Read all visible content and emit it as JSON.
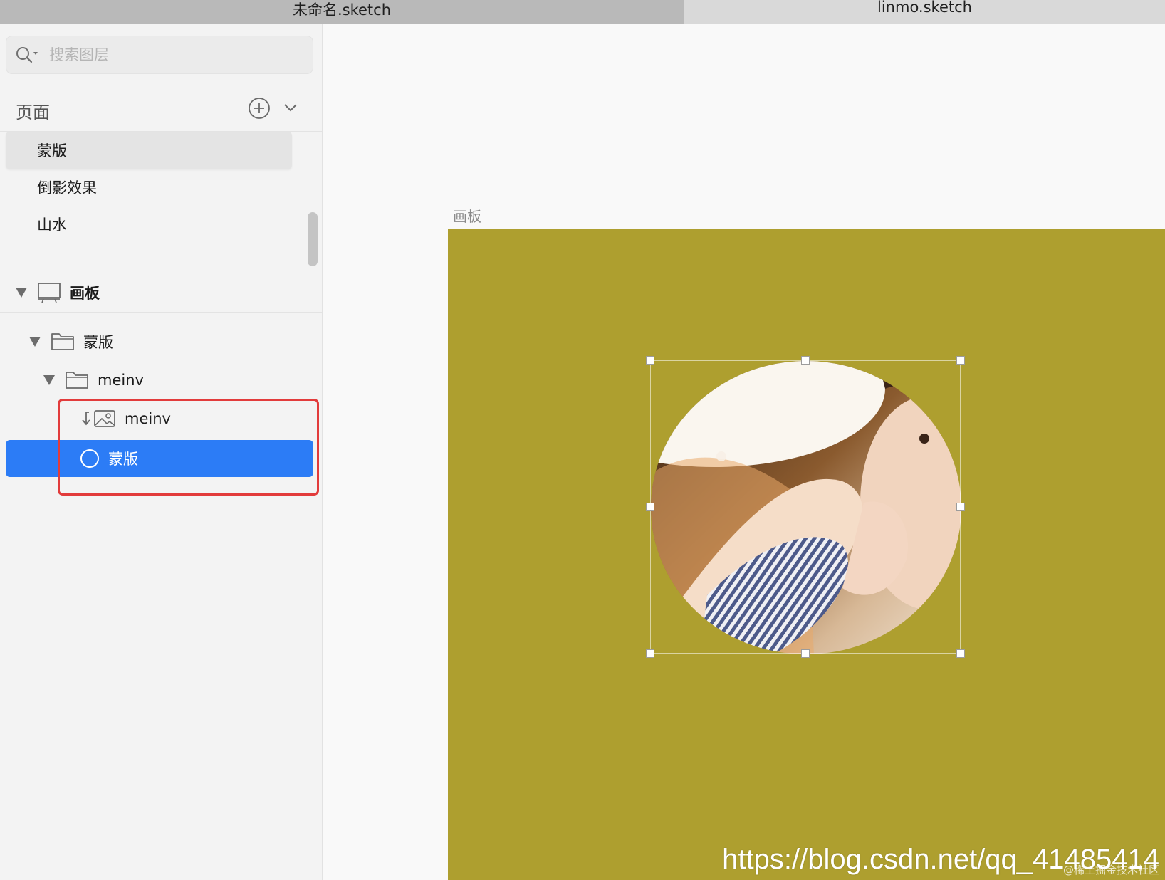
{
  "tabs": [
    {
      "label": "未命名.sketch",
      "active": true
    },
    {
      "label": "linmo.sketch",
      "active": false
    }
  ],
  "sidebar": {
    "search": {
      "placeholder": "搜索图层",
      "value": ""
    },
    "pages": {
      "title": "页面",
      "items": [
        {
          "label": "蒙版",
          "selected": true
        },
        {
          "label": "倒影效果",
          "selected": false
        },
        {
          "label": "山水",
          "selected": false
        }
      ]
    },
    "layers": {
      "artboard": {
        "label": "画板",
        "icon": "artboard-icon"
      },
      "group_mask": {
        "label": "蒙版",
        "icon": "folder-icon"
      },
      "group_meinv": {
        "label": "meinv",
        "icon": "folder-icon"
      },
      "image_layer": {
        "label": "meinv",
        "icon": "image-icon"
      },
      "mask_layer": {
        "label": "蒙版",
        "icon": "oval-icon",
        "selected": true
      }
    }
  },
  "canvas": {
    "artboard_title": "画板",
    "artboard_color": "#ae9f2f",
    "watermark": "https://blog.csdn.net/qq_41485414",
    "watermark_small": "@稀土掘金技术社区"
  },
  "colors": {
    "selection": "#2c7cf6",
    "highlight": "#e23b3b"
  }
}
